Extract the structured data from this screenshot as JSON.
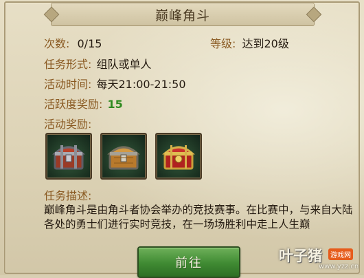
{
  "title": "巅峰角斗",
  "times": {
    "label": "次数:",
    "value": "0/15"
  },
  "level": {
    "label": "等级:",
    "value": "达到20级"
  },
  "form": {
    "label": "任务形式:",
    "value": "组队或单人"
  },
  "time": {
    "label": "活动时间:",
    "value": "每天21:00-21:50"
  },
  "activity": {
    "label": "活跃度奖励:",
    "value": "15"
  },
  "rewards": {
    "label": "活动奖励:",
    "items": [
      {
        "icon": "silver-chest-icon",
        "color": "#b8422a"
      },
      {
        "icon": "bronze-chest-icon",
        "color": "#c9892f"
      },
      {
        "icon": "gold-chest-icon",
        "color": "#c0262a"
      }
    ]
  },
  "description": {
    "label": "任务描述:",
    "text": "巅峰角斗是由角斗者协会举办的竞技赛事。在比赛中，与来自大陆各处的勇士们进行实时竞技，在一场场胜利中走上人生巅"
  },
  "go_button": {
    "label": "前往",
    "color": "#3f8a32"
  },
  "watermark": {
    "main": "叶子猪",
    "badge": "游戏网",
    "url": "www.yzz.cn"
  }
}
